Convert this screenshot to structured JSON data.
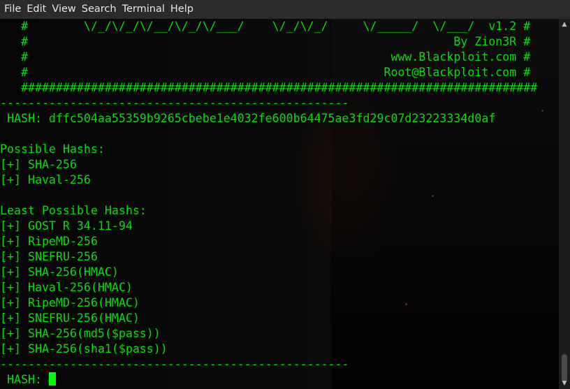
{
  "menubar": {
    "items": [
      "File",
      "Edit",
      "View",
      "Search",
      "Terminal",
      "Help"
    ]
  },
  "terminal": {
    "text_color": "#00e000",
    "cursor_color": "#00ff00",
    "lines": [
      "   #        \\/_/\\/_/\\/__/\\/_/\\/___/    \\/_/\\/_/     \\/_____/  \\/___/  v1.2 #",
      "   #                                                             By Zion3R #",
      "   #                                                    www.Blackploit.com #",
      "   #                                                   Root@Blackploit.com #",
      "   ##########################################################################",
      "--------------------------------------------------",
      " HASH: dffc504aa55359b9265cbebe1e4032fe600b64475ae3fd29c07d23223334d0af",
      "",
      "Possible Hashs:",
      "[+] SHA-256",
      "[+] Haval-256",
      "",
      "Least Possible Hashs:",
      "[+] GOST R 34.11-94",
      "[+] RipeMD-256",
      "[+] SNEFRU-256",
      "[+] SHA-256(HMAC)",
      "[+] Haval-256(HMAC)",
      "[+] RipeMD-256(HMAC)",
      "[+] SNEFRU-256(HMAC)",
      "[+] SHA-256(md5($pass))",
      "[+] SHA-256(sha1($pass))",
      "--------------------------------------------------"
    ],
    "prompt": " HASH: "
  },
  "icons": {
    "scroll_up": "scroll-up-arrow-icon",
    "scroll_down": "scroll-down-arrow-icon"
  }
}
